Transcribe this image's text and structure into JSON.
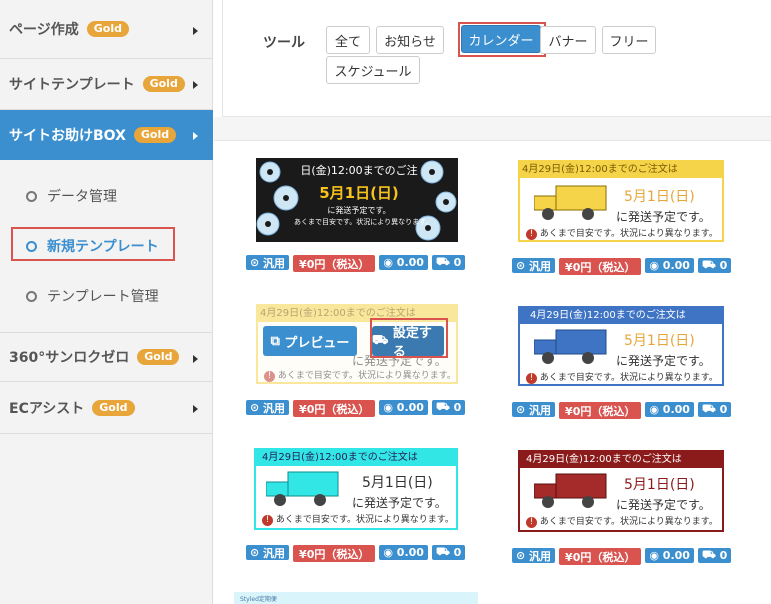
{
  "sidebar": {
    "items": [
      {
        "label": "ページ作成",
        "badge": "Gold"
      },
      {
        "label": "サイトテンプレート",
        "badge": "Gold"
      },
      {
        "label": "サイトお助けBOX",
        "badge": "Gold",
        "active": true
      },
      {
        "label": "360°サンロクゼロ",
        "badge": "Gold"
      },
      {
        "label": "ECアシスト",
        "badge": "Gold"
      }
    ],
    "subitems": [
      {
        "label": "データ管理"
      },
      {
        "label": "新規テンプレート",
        "current": true
      },
      {
        "label": "テンプレート管理"
      }
    ]
  },
  "toolbar": {
    "label": "ツール",
    "filters": [
      "全て",
      "お知らせ",
      "カレンダー",
      "バナー",
      "フリー",
      "スケジュール"
    ],
    "selected": "カレンダー"
  },
  "card_text": {
    "order_line": "4月29日(金)12:00までのご注文は",
    "order_line_short": "日(金)12:00までのご注",
    "ship_date": "5月1日(日)",
    "ship_note": "に発送予定です。",
    "disclaimer": "あくまで目安です。状況により異なります。"
  },
  "card_meta": {
    "type": "汎用",
    "price": "¥0円（税込）",
    "rating": "0.00",
    "count": "0"
  },
  "overlay": {
    "preview": "プレビュー",
    "set": "設定する"
  },
  "partial_card_label": "Styled定期便",
  "colors": {
    "accent": "#3b8fcf",
    "gold": "#e8a53a",
    "danger": "#d9534f",
    "yellow": "#f5d44a",
    "cyan": "#33e6e6",
    "darkred": "#8b1a1a",
    "blue": "#3f74c4"
  }
}
